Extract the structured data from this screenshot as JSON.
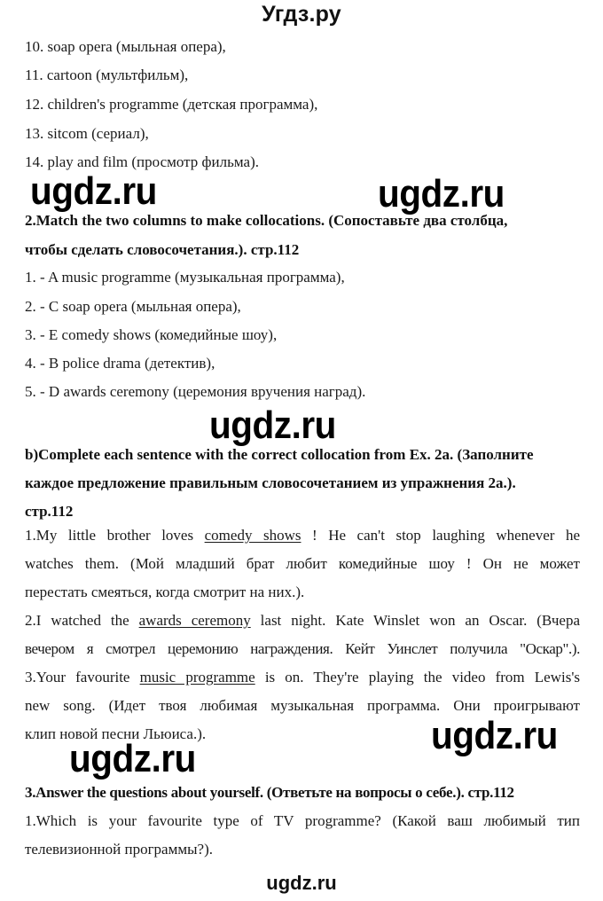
{
  "header": {
    "site_title": "Угдз.ру"
  },
  "list_continued": [
    "10. soap opera (мыльная опера),",
    "11. cartoon (мультфильм),",
    "12. children's programme (детская программа),",
    "13. sitcom (сериал),",
    "14. play and film (просмотр фильма)."
  ],
  "exercise2": {
    "title_line1": "2.Match the two columns to make collocations. (Сопоставьте два столбца,",
    "title_line2": "чтобы сделать словосочетания.). стр.112",
    "answers": [
      "1. - A music programme (музыкальная программа),",
      "2. - C soap  opera (мыльная опера),",
      "3. - E comedy shows (комедийные шоу),",
      "4. - B police drama (детектив),",
      "5. - D awards ceremony (церемония вручения наград)."
    ]
  },
  "exercise2b": {
    "title_line1": "b)Complete each sentence with the correct collocation from Ex. 2a. (Заполните",
    "title_line2": "каждое предложение правильным словосочетанием из упражнения 2а.).",
    "title_line3": "стр.112",
    "sentences": [
      {
        "l1_pre": "1.My little brother loves ",
        "l1_answer": "comedy shows",
        "l1_post": " ! He can't stop laughing whenever he",
        "l2": "watches them. (Мой младший брат любит комедийные шоу ! Он не может",
        "l3": "перестать смеяться, когда смотрит на них.)."
      },
      {
        "l1_pre": "2.I watched the ",
        "l1_answer": "awards ceremony",
        "l1_post": " last night. Kate Winslet won an Oscar. (Вчера",
        "l2": "вечером я смотрел церемонию награждения. Кейт Уинслет получила \"Оскар\".)."
      },
      {
        "l1_pre": "3.Your favourite ",
        "l1_answer": "music programme",
        "l1_post": " is on. They're playing the video from Lewis's",
        "l2": "new song. (Идет твоя любимая музыкальная программа. Они проигрывают",
        "l3": "клип новой песни Льюиса.)."
      }
    ]
  },
  "exercise3": {
    "title": "3.Answer the questions about yourself. (Ответьте на вопросы о себе.). стр.112",
    "questions": [
      {
        "l1": "1.Which is your favourite type of TV programme? (Какой ваш любимый тип",
        "l2": "телевизионной программы?)."
      }
    ]
  },
  "watermarks": [
    "ugdz.ru",
    "ugdz.ru",
    "ugdz.ru",
    "ugdz.ru",
    "ugdz.ru"
  ],
  "footer": {
    "site_title": "ugdz.ru"
  }
}
